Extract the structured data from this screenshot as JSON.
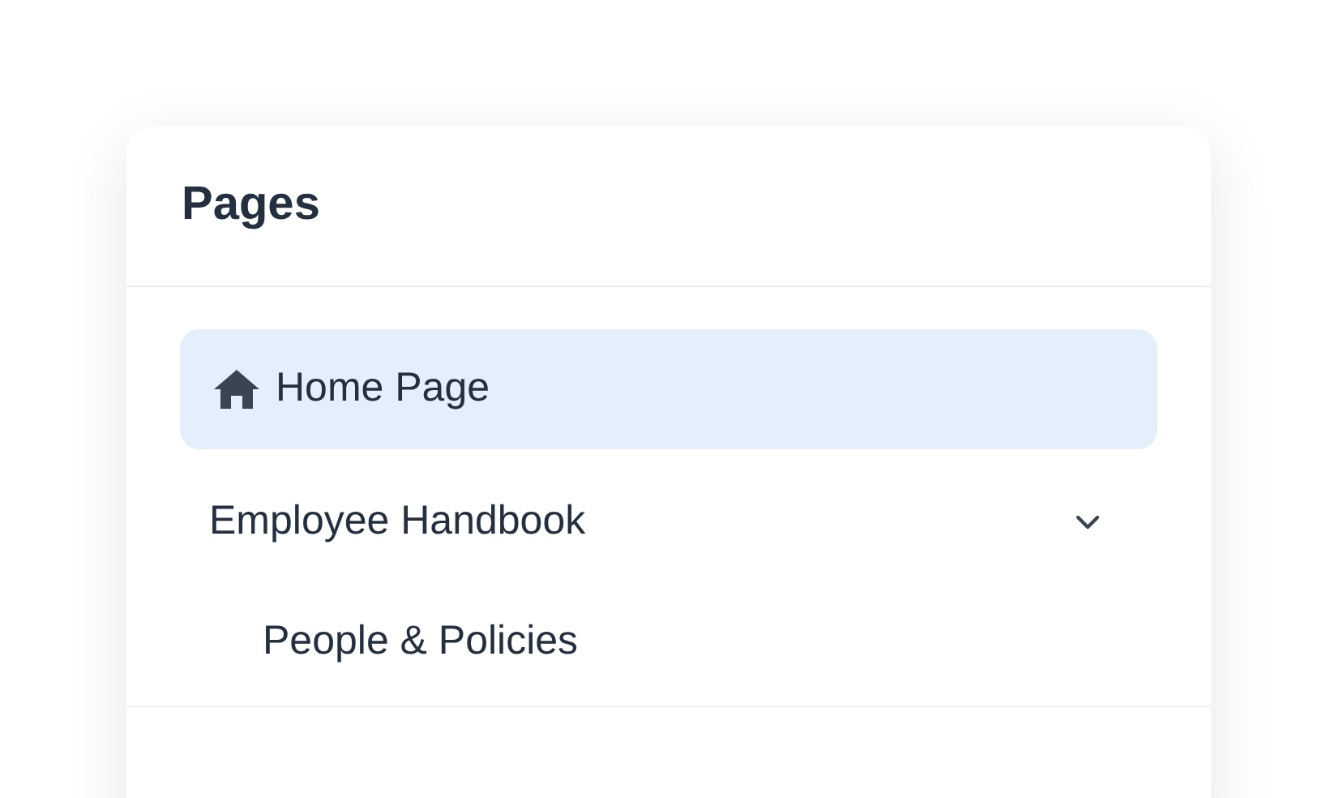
{
  "panel": {
    "title": "Pages"
  },
  "pages": [
    {
      "label": "Home Page",
      "kind": "home",
      "selected": true
    },
    {
      "label": "Employee Handbook",
      "kind": "section",
      "selected": false,
      "expanded": true,
      "children": [
        {
          "label": "People & Policies",
          "kind": "page",
          "selected": false
        }
      ]
    }
  ]
}
